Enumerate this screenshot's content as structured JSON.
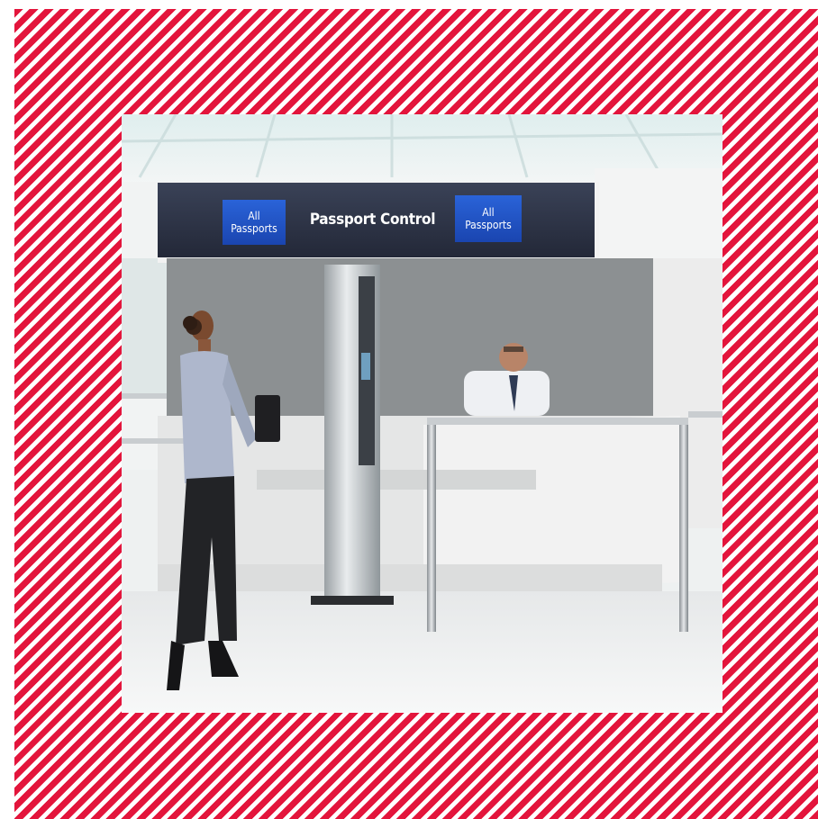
{
  "sign": {
    "center_label": "Passport Control",
    "left_badge": [
      "All",
      "Passports"
    ],
    "right_badge": [
      "All",
      "Passports"
    ]
  },
  "colors": {
    "stripe_red": "#e3153c",
    "sign_bar": "#2f3648",
    "badge_blue": "#1f4fc1"
  }
}
